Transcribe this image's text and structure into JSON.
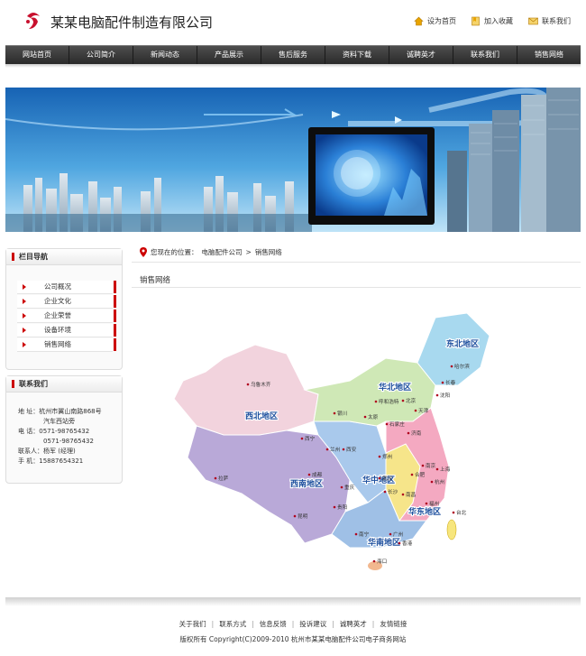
{
  "header": {
    "company_name": "某某电脑配件制造有限公司",
    "links": {
      "home": "设为首页",
      "favorite": "加入收藏",
      "contact": "联系我们"
    }
  },
  "nav": [
    "网站首页",
    "公司简介",
    "新闻动态",
    "产品展示",
    "售后服务",
    "资料下载",
    "诚聘英才",
    "联系我们",
    "销售网络"
  ],
  "sidebar": {
    "nav_title": "栏目导航",
    "items": [
      "公司概况",
      "企业文化",
      "企业荣誉",
      "设备环境",
      "销售网络"
    ],
    "contact_title": "联系我们",
    "contact": {
      "address_label": "地  址：",
      "address": "杭州市翼山南路868号",
      "address2": "汽车西站旁",
      "phone_label": "电  话：",
      "phone1": "0571-98765432",
      "phone2": "0571-98765432",
      "person_label": "联系人：",
      "person": "杨军 (经理)",
      "mobile_label": "手  机：",
      "mobile": "15887654321"
    }
  },
  "breadcrumb": {
    "prefix": "您现在的位置：",
    "home": "电脑配件公司",
    "sep": ">",
    "current": "销售网络"
  },
  "section_title": "销售网络",
  "map": {
    "regions": [
      "东北地区",
      "华北地区",
      "西北地区",
      "西南地区",
      "华中地区",
      "华东地区",
      "华南地区"
    ],
    "cities": [
      "乌鲁木齐",
      "哈尔滨",
      "长春",
      "沈阳",
      "北京",
      "天津",
      "呼和浩特",
      "太原",
      "石家庄",
      "银川",
      "兰州",
      "西宁",
      "西安",
      "郑州",
      "济南",
      "南京",
      "合肥",
      "上海",
      "杭州",
      "武汉",
      "长沙",
      "南昌",
      "福州",
      "成都",
      "重庆",
      "贵阳",
      "昆明",
      "拉萨",
      "南宁",
      "广州",
      "香港",
      "海口",
      "台北"
    ]
  },
  "footer": {
    "links": [
      "关于我们",
      "联系方式",
      "信息反馈",
      "投诉建议",
      "诚聘英才",
      "友情链接"
    ],
    "copyright": "版权所有 Copyright(C)2009-2010 杭州市某某电脑配件公司电子商务网站"
  }
}
